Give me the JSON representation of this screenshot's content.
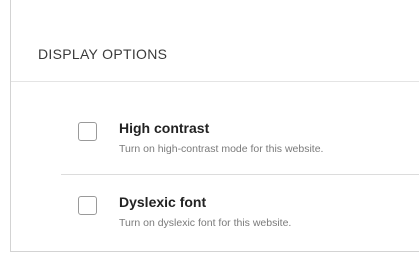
{
  "panel": {
    "title": "DISPLAY OPTIONS"
  },
  "options": [
    {
      "label": "High contrast",
      "description": "Turn on high-contrast mode for this website.",
      "checked": false
    },
    {
      "label": "Dyslexic font",
      "description": "Turn on dyslexic font for this website.",
      "checked": false
    }
  ],
  "colors": {
    "text_primary": "#222222",
    "text_secondary": "#7a7a7a",
    "border": "#d3d3d3"
  }
}
